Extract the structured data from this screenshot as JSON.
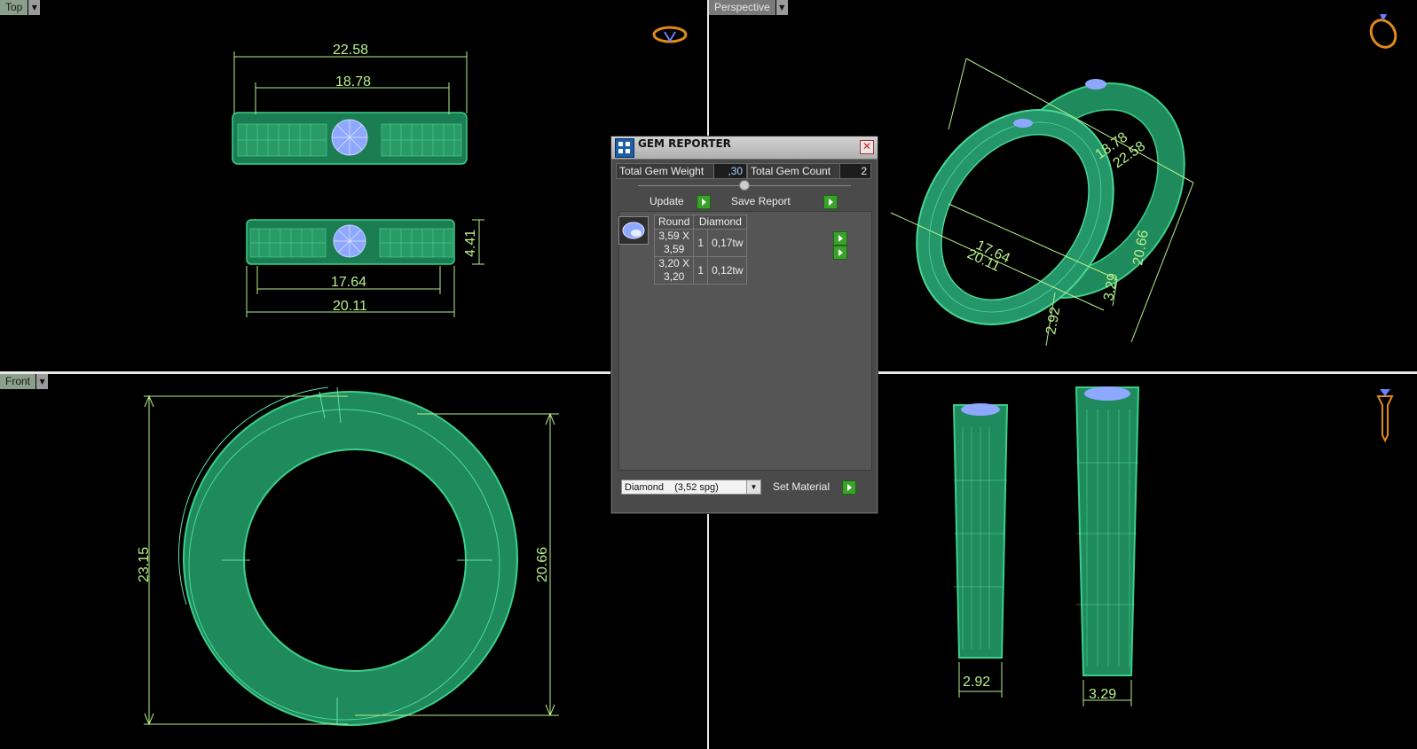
{
  "viewports": {
    "top": {
      "label": "Top"
    },
    "perspective": {
      "label": "Perspective"
    },
    "front": {
      "label": "Front"
    }
  },
  "top_dims": {
    "d1": "22.58",
    "d2": "18.78",
    "d3": "4.41",
    "d4": "17.64",
    "d5": "20.11"
  },
  "front_dims": {
    "height": "23.15",
    "inner": "20.66"
  },
  "perspective_dims": {
    "a": "17.64",
    "b": "20.11",
    "c": "20.66",
    "d": "2.92",
    "e": "3.29",
    "f": "22.58",
    "g": "18.78"
  },
  "side_dims": {
    "left": "2.92",
    "right": "3.29"
  },
  "gem_reporter": {
    "title": "GEM REPORTER",
    "total_weight_label": "Total Gem Weight",
    "total_weight_value": ",30",
    "total_count_label": "Total Gem Count",
    "total_count_value": "2",
    "update_label": "Update",
    "save_label": "Save Report",
    "table": {
      "headers": [
        "Round",
        "Diamond"
      ],
      "rows": [
        {
          "size": "3,59 X 3,59",
          "count": "1",
          "weight": "0,17tw"
        },
        {
          "size": "3,20 X 3,20",
          "count": "1",
          "weight": "0,12tw"
        }
      ]
    },
    "material_select": "Diamond    (3,52 spg)",
    "set_material_label": "Set Material"
  },
  "colors": {
    "ring": "#1f8a5c",
    "dim": "#b8f08a",
    "gem": "#8fa8ff"
  }
}
